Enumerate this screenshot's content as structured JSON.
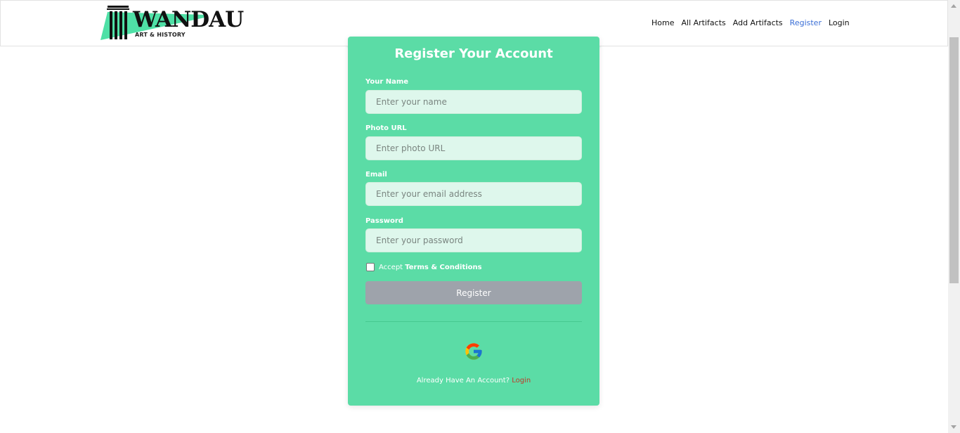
{
  "nav": {
    "logo_text": "WANDAU",
    "logo_subtitle": "ART & HISTORY",
    "links": [
      {
        "label": "Home"
      },
      {
        "label": "All Artifacts"
      },
      {
        "label": "Add Artifacts"
      },
      {
        "label": "Register"
      },
      {
        "label": "Login"
      }
    ],
    "active_link": "Register"
  },
  "form": {
    "title": "Register Your Account",
    "fields": [
      {
        "label": "Your Name",
        "placeholder": "Enter your name",
        "value": ""
      },
      {
        "label": "Photo URL",
        "placeholder": "Enter photo URL",
        "value": ""
      },
      {
        "label": "Email",
        "placeholder": "Enter your email address",
        "value": ""
      },
      {
        "label": "Password",
        "placeholder": "Enter your password",
        "value": ""
      }
    ],
    "terms_prefix": "Accept ",
    "terms_link": "Terms & Conditions",
    "terms_checked": false,
    "submit_label": "Register",
    "google_icon": "google-icon",
    "footer_text": "Already Have An Account? ",
    "footer_link": "Login"
  },
  "colors": {
    "card": "#5bdca6",
    "input_bg": "#def7ec",
    "button": "#9ea3ab",
    "active_nav": "#3b6fd6",
    "footer_link": "#c0392b"
  }
}
